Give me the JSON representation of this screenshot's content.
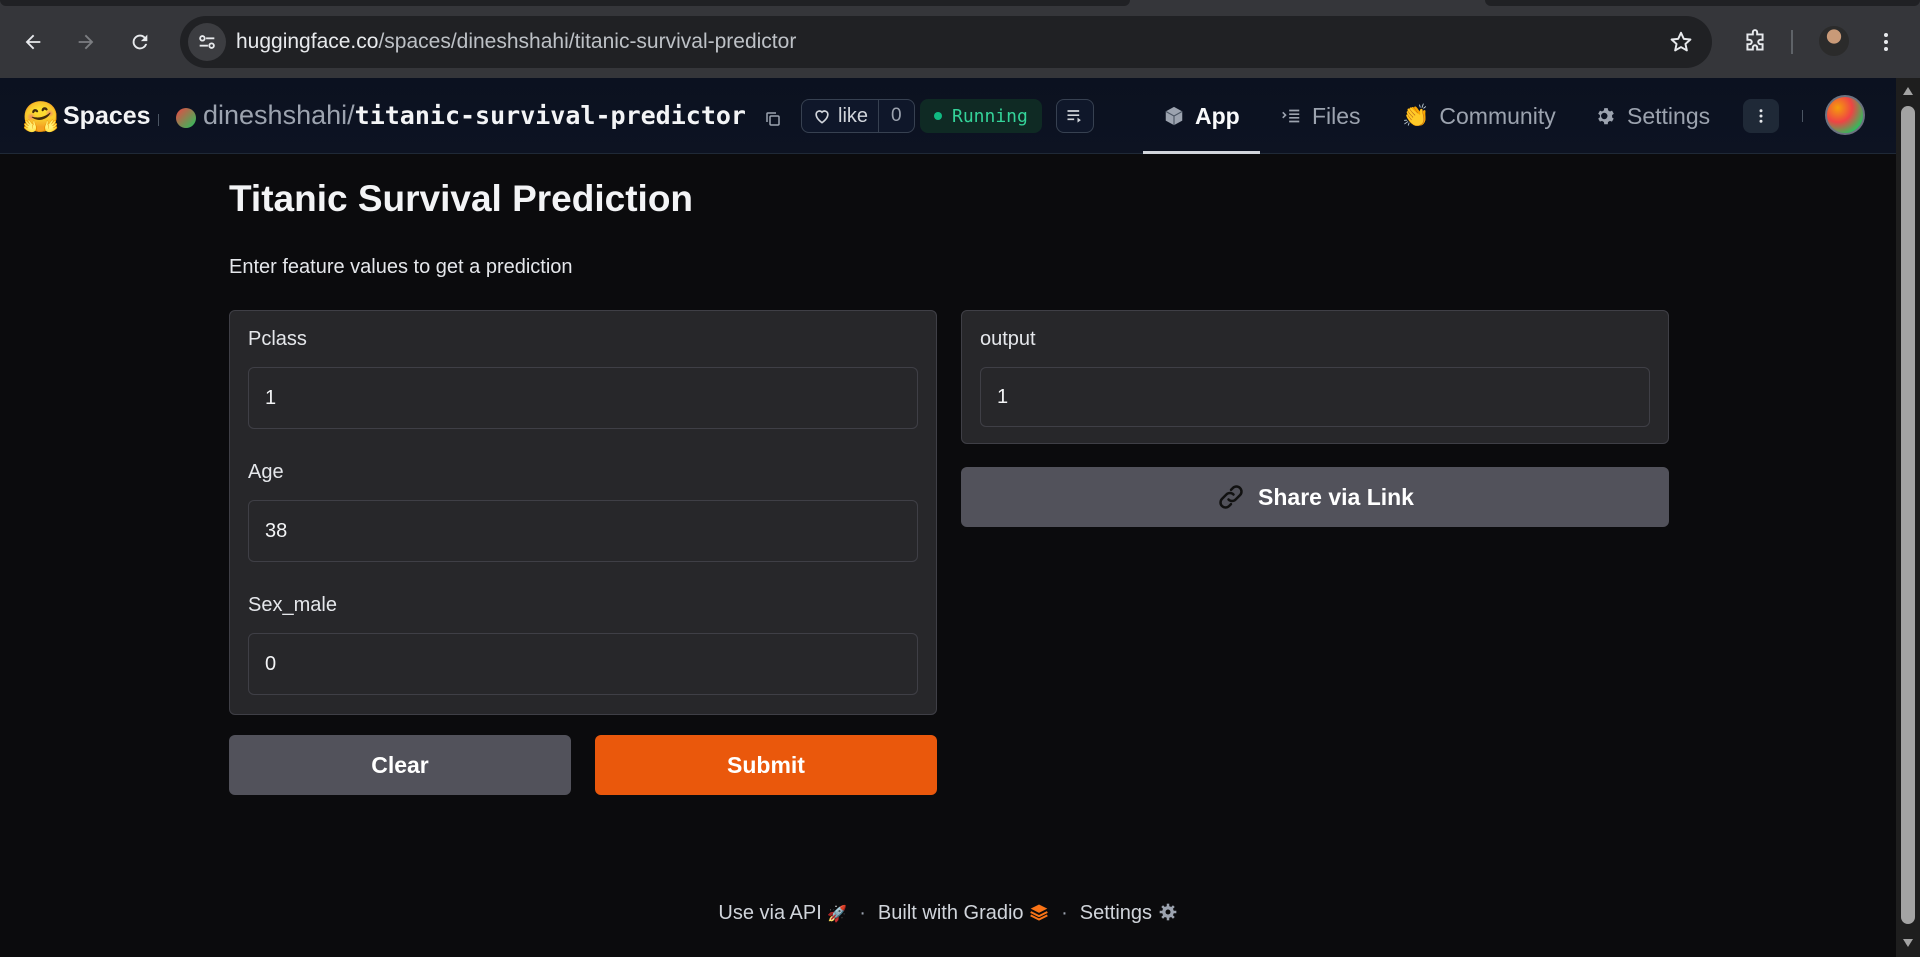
{
  "browser": {
    "url_host": "huggingface.co",
    "url_path": "/spaces/dineshshahi/titanic-survival-predictor"
  },
  "header": {
    "spaces_label": "Spaces",
    "owner": "dineshshahi",
    "slash": "/",
    "space_name": "titanic-survival-predictor",
    "like_label": "like",
    "like_count": "0",
    "status": "Running",
    "tabs": [
      {
        "label": "App",
        "icon": "cube-icon",
        "active": true
      },
      {
        "label": "Files",
        "icon": "files-icon",
        "active": false
      },
      {
        "label": "Community",
        "icon": "clap-icon",
        "active": false
      },
      {
        "label": "Settings",
        "icon": "gear-icon",
        "active": false
      }
    ]
  },
  "app": {
    "title": "Titanic Survival Prediction",
    "description": "Enter feature values to get a prediction",
    "inputs": [
      {
        "label": "Pclass",
        "value": "1"
      },
      {
        "label": "Age",
        "value": "38"
      },
      {
        "label": "Sex_male",
        "value": "0"
      }
    ],
    "output": {
      "label": "output",
      "value": "1"
    },
    "share_label": "Share via Link",
    "clear_label": "Clear",
    "submit_label": "Submit"
  },
  "footer": {
    "api_label": "Use via API",
    "built_label": "Built with Gradio",
    "settings_label": "Settings",
    "separator": "·"
  },
  "colors": {
    "accent": "#ea580c",
    "running": "#10b981",
    "background": "#0b0b0d",
    "panel": "#27272a"
  }
}
